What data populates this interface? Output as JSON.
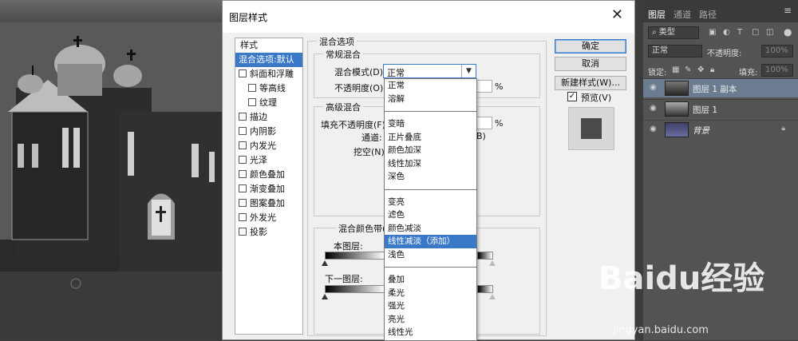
{
  "dialog": {
    "title": "图层样式",
    "close_icon": "close-icon",
    "styles_header": "样式",
    "styles": [
      {
        "label": "混合选项:默认",
        "selected": true,
        "checkbox": false
      },
      {
        "label": "斜面和浮雕",
        "checkbox": true
      },
      {
        "label": "等高线",
        "checkbox": true,
        "sub": true
      },
      {
        "label": "纹理",
        "checkbox": true,
        "sub": true
      },
      {
        "label": "描边",
        "checkbox": true
      },
      {
        "label": "内阴影",
        "checkbox": true
      },
      {
        "label": "内发光",
        "checkbox": true
      },
      {
        "label": "光泽",
        "checkbox": true
      },
      {
        "label": "颜色叠加",
        "checkbox": true
      },
      {
        "label": "渐变叠加",
        "checkbox": true
      },
      {
        "label": "图案叠加",
        "checkbox": true
      },
      {
        "label": "外发光",
        "checkbox": true
      },
      {
        "label": "投影",
        "checkbox": true
      }
    ],
    "blend_options_label": "混合选项",
    "general_blend_label": "常规混合",
    "blend_mode_label": "混合模式(D):",
    "blend_mode_value": "正常",
    "opacity_label": "不透明度(O):",
    "opacity_unit": "%",
    "advanced_blend_label": "高级混合",
    "fill_opacity_label": "填充不透明度(F):",
    "fill_unit": "%",
    "channels_label": "通道:",
    "channel_b": "B)",
    "knockout_label": "挖空(N):",
    "blend_if_label": "混合颜色带(",
    "this_layer_label": "本图层:",
    "underlying_layer_label": "下一图层:",
    "buttons": {
      "ok": "确定",
      "cancel": "取消",
      "new_style": "新建样式(W)...",
      "preview": "预览(V)"
    },
    "preview_checked": true
  },
  "blend_dropdown": {
    "groups": [
      [
        "正常",
        "溶解"
      ],
      [
        "变暗",
        "正片叠底",
        "颜色加深",
        "线性加深",
        "深色"
      ],
      [
        "变亮",
        "滤色",
        "颜色减淡",
        "线性减淡（添加）",
        "浅色"
      ],
      [
        "叠加",
        "柔光",
        "强光",
        "亮光",
        "线性光"
      ]
    ],
    "highlighted": "线性减淡（添加）"
  },
  "layers_panel": {
    "tabs": [
      "图层",
      "通道",
      "路径"
    ],
    "active_tab": "图层",
    "filter_kind": "类型",
    "blend_mode": "正常",
    "opacity_label": "不透明度:",
    "opacity_value": "100%",
    "lock_label": "锁定:",
    "fill_label": "填充:",
    "fill_value": "100%",
    "layers": [
      {
        "name": "图层 1 副本",
        "selected": true,
        "thumb": "inv"
      },
      {
        "name": "图层 1",
        "selected": false,
        "thumb": "bw"
      },
      {
        "name": "背景",
        "selected": false,
        "thumb": "color",
        "italic": true,
        "locked": true
      }
    ]
  },
  "watermark": {
    "brand": "Baidu经验",
    "url": "jingyan.baidu.com"
  }
}
